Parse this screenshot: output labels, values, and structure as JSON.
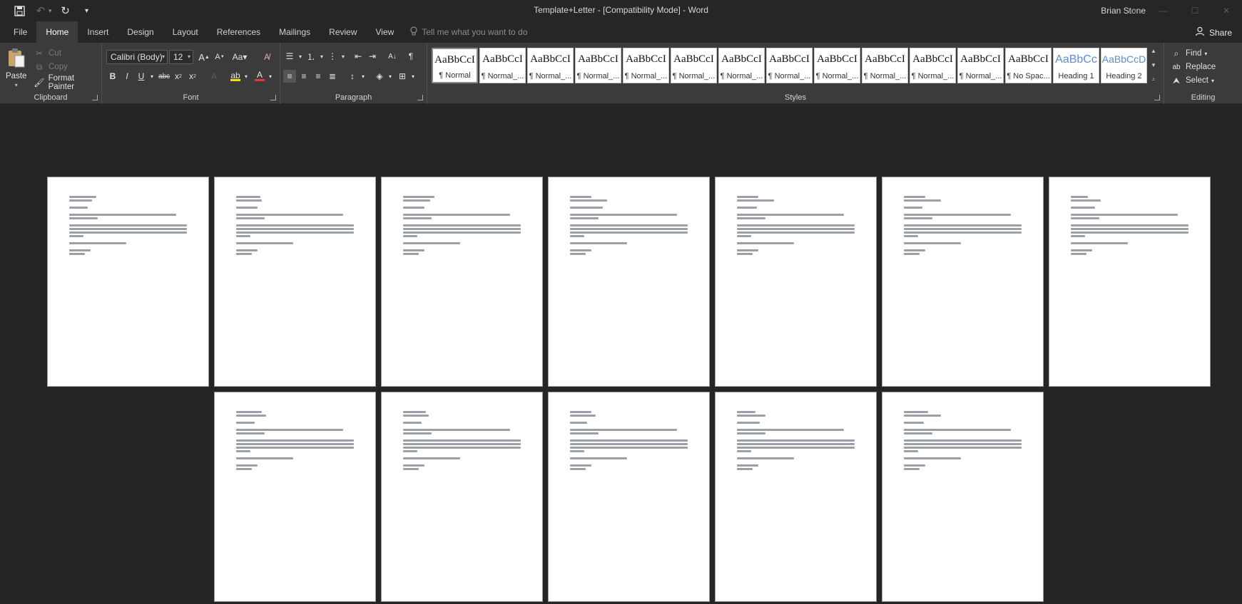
{
  "window": {
    "title": "Template+Letter - [Compatibility Mode]  -  Word",
    "user": "Brian Stone"
  },
  "tabs": [
    "File",
    "Home",
    "Insert",
    "Design",
    "Layout",
    "References",
    "Mailings",
    "Review",
    "View"
  ],
  "active_tab": "Home",
  "tellme": "Tell me what you want to do",
  "share": "Share",
  "clipboard": {
    "label": "Clipboard",
    "paste": "Paste",
    "cut": "Cut",
    "copy": "Copy",
    "format_painter": "Format Painter"
  },
  "font": {
    "label": "Font",
    "name": "Calibri (Body)",
    "size": "12"
  },
  "paragraph": {
    "label": "Paragraph"
  },
  "styles": {
    "label": "Styles",
    "items": [
      {
        "preview": "AaBbCcI",
        "name": "¶ Normal"
      },
      {
        "preview": "AaBbCcI",
        "name": "¶ Normal_..."
      },
      {
        "preview": "AaBbCcI",
        "name": "¶ Normal_..."
      },
      {
        "preview": "AaBbCcI",
        "name": "¶ Normal_..."
      },
      {
        "preview": "AaBbCcI",
        "name": "¶ Normal_..."
      },
      {
        "preview": "AaBbCcI",
        "name": "¶ Normal_..."
      },
      {
        "preview": "AaBbCcI",
        "name": "¶ Normal_..."
      },
      {
        "preview": "AaBbCcI",
        "name": "¶ Normal_..."
      },
      {
        "preview": "AaBbCcI",
        "name": "¶ Normal_..."
      },
      {
        "preview": "AaBbCcI",
        "name": "¶ Normal_..."
      },
      {
        "preview": "AaBbCcI",
        "name": "¶ Normal_..."
      },
      {
        "preview": "AaBbCcI",
        "name": "¶ Normal_..."
      },
      {
        "preview": "AaBbCcI",
        "name": "¶ No Spac..."
      },
      {
        "preview": "AaBbCc",
        "name": "Heading 1"
      },
      {
        "preview": "AaBbCcD",
        "name": "Heading 2"
      }
    ]
  },
  "editing": {
    "label": "Editing",
    "find": "Find",
    "replace": "Replace",
    "select": "Select"
  },
  "colors": {
    "highlight": "#f5e000",
    "font_color": "#e23b3b"
  }
}
